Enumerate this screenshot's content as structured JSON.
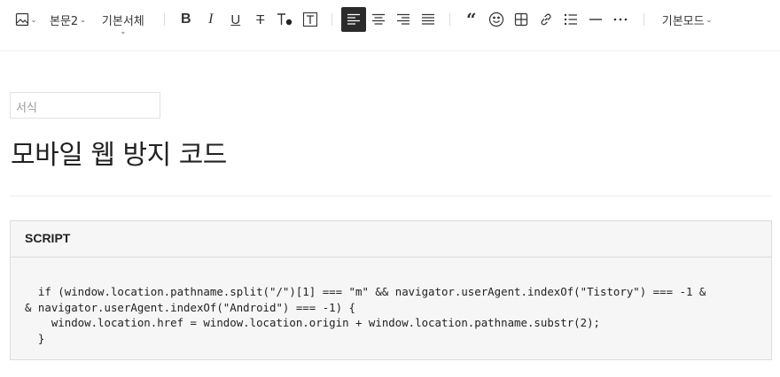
{
  "toolbar": {
    "image_icon": "image-icon",
    "paragraph_style": "본문2",
    "font_family": "기본서체",
    "mode": "기본모드",
    "colors": {
      "active_bg": "#2b2b2b",
      "icon": "#333333"
    }
  },
  "editor": {
    "format_placeholder": "서식",
    "title": "모바일 웹 방지 코드"
  },
  "code_block": {
    "label": "SCRIPT",
    "lines": [
      "  if (window.location.pathname.split(\"/\")[1] === \"m\" && navigator.userAgent.indexOf(\"Tistory\") === -1 &",
      "& navigator.userAgent.indexOf(\"Android\") === -1) {",
      "    window.location.href = window.location.origin + window.location.pathname.substr(2);",
      "  }"
    ]
  }
}
